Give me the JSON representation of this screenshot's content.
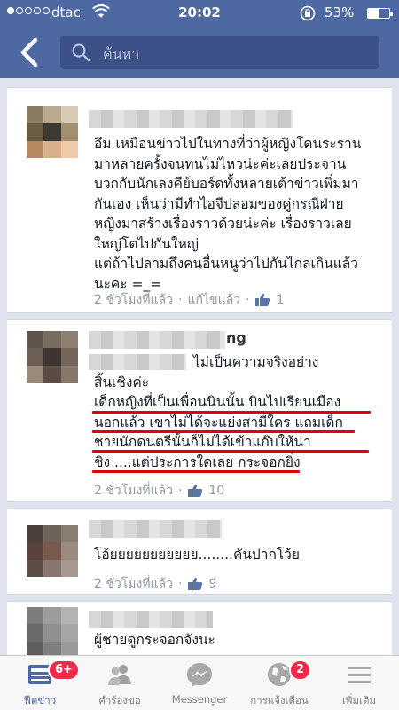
{
  "status_bar": {
    "carrier": "dtac",
    "time": "20:02",
    "battery": "53%"
  },
  "search": {
    "placeholder": "ค้นหา"
  },
  "comments": [
    {
      "name_tail": "",
      "lines": [
        "อึม เหมือนข่าวไปในทางที่ว่าผู้หญิงโดนระราน",
        "มาหลายครั้งจนทนไม่ไหวน่ะค่ะเลยประจาน",
        "บวกกับนักเลงคีย์บอร์ดทั้งหลายเต้าข่าวเพิ่มมา",
        "กันเอง เห็นว่ามีทำไอจีปลอมของคู่กรณีฝ่าย",
        "หญิงมาสร้างเรื่องราวด้วยน่ะค่ะ เรื่องราวเลย",
        "ใหญ่โตไปกันใหญ่",
        "แต่ถ้าไปลามถึงคนอื่นหนูว่าไปกันไกลเกินแล้ว",
        "นะคะ =_="
      ],
      "time": "2 ชั่วโมงที่แล้ว",
      "edited": "แก้ไขแล้ว",
      "likes": "1"
    },
    {
      "name_tail": "ng",
      "lines": [
        "ไม่เป็นความจริงอย่าง",
        "สิ้นเชิงค่ะ",
        "เด็กหญิงที่เป็นเพื่อนนินนั้น บินไปเรียนเมือง",
        "นอกแล้ว เขาไม่ได้จะแย่งสามีใคร แถมเด็ก",
        "ชายนักดนตรีนั้นก็ไม่ได้เข้าแก๊บให้น่า",
        "ชิง ....แต่ประการใดเลย กระจอกยิ่ง"
      ],
      "time": "2 ชั่วโมงที่แล้ว",
      "likes": "10"
    },
    {
      "name_tail": "",
      "lines": [
        "โอ้ยยยยยยยยยยย........คันปากโว้ย"
      ],
      "time": "2 ชั่วโมงที่แล้ว",
      "likes": "9"
    },
    {
      "name_tail": "",
      "lines": [
        "ผู้ชายดูกระจอกจังนะ"
      ]
    }
  ],
  "tabs": [
    {
      "label": "ฟีดข่าว",
      "icon": "news-feed-icon",
      "badge": "6+"
    },
    {
      "label": "คำร้องขอ",
      "icon": "friend-requests-icon"
    },
    {
      "label": "Messenger",
      "icon": "messenger-icon"
    },
    {
      "label": "การแจ้งเตือน",
      "icon": "globe-notifications-icon",
      "badge": "2"
    },
    {
      "label": "เพิ่มเติม",
      "icon": "menu-icon"
    }
  ],
  "colors": {
    "brand": "#4e69a2",
    "underline": "#e00000",
    "badge": "#f02849"
  }
}
